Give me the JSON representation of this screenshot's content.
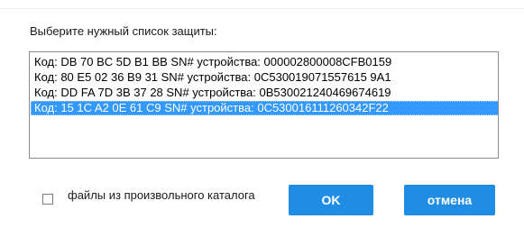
{
  "dialog": {
    "prompt": "Выберите нужный список защиты:",
    "list_items": [
      "Код: DB 70 BC 5D B1 BB SN# устройства: 000002800008CFB0159",
      "Код: 80 E5 02 36 B9 31 SN# устройства: 0C530019071557615 9A1",
      "Код: DD FA 7D 3B 37 28 SN# устройства: 0B530021240469674619",
      "Код: 15 1C A2 0E 61 C9 SN# устройства: 0C530016111260342F22"
    ],
    "selected_index": 3,
    "checkbox_label": "файлы из произвольного каталога",
    "checkbox_checked": false,
    "ok_label": "OK",
    "cancel_label": "отмена"
  },
  "colors": {
    "accent": "#1f8de4",
    "selection": "#3399ff"
  }
}
